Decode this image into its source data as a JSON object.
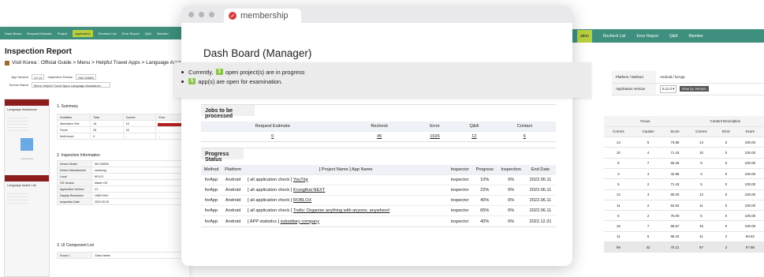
{
  "left_window": {
    "nav": [
      "Dash Board",
      "Request Estimate",
      "Project",
      "Application",
      "Recheck List",
      "Error Report",
      "Q&A",
      "Member"
    ],
    "nav_active": "Application",
    "title": "Inspection Report",
    "breadcrumb": "Visit Korea : Official Guide > Menu > Helpful Travel Apps > Language Assist",
    "app_version_label": "App Version",
    "app_version_value": "V2.12",
    "inspection_device_label": "Inspection Device",
    "inspection_device_value": "SM-G960N",
    "screen_name_label": "Screen Name",
    "screen_name_value": "Menu Helpful Travel Apps Language Assistance",
    "phone_heading": "Language Assistance",
    "phone_heading_2": "Language Assist  List",
    "phone_apps_label": "Applications",
    "summary_title": "1. Summary",
    "summary_headers": [
      "Guideline",
      "Total",
      "Correct",
      "Error"
    ],
    "summary_rows": [
      [
        "Alternative Text",
        "16",
        "15",
        "0"
      ],
      [
        "Focus",
        "28",
        "16",
        "-"
      ],
      [
        "Multi-touch",
        "0",
        "-",
        "-"
      ]
    ],
    "inspection_info_title": "2. Inspection Information",
    "inspection_info": [
      [
        "Device Model",
        "SM-G960N"
      ],
      [
        "Device Manufacturer",
        "samsung"
      ],
      [
        "Local",
        "KR-KO"
      ],
      [
        "OS Version",
        "Maker OS"
      ],
      [
        "Application Version",
        "V1"
      ],
      [
        "Display Resolution",
        "1080*1920"
      ],
      [
        "Inspection Date",
        "2022.05.25"
      ]
    ],
    "ui_component_title": "3. UI Component List",
    "ui_component_first": "Focus 1.",
    "ui_component_col": "Class Name"
  },
  "right_window": {
    "nav": [
      "ation",
      "Recheck List",
      "Error Report",
      "Q&A",
      "Member"
    ],
    "platform_label": "Platform / Method",
    "platform_value": "Android / forApp",
    "appver_label": "Application Version",
    "appver_value": "5.11.0",
    "view_button": "View by Version",
    "focus_header": "Focus",
    "content_header": "Content Description",
    "sub_headers": [
      "Correct",
      "Caution",
      "Score",
      "Correct",
      "Error",
      "Score"
    ],
    "rows": [
      [
        "14",
        "5",
        "73.68",
        "14",
        "0",
        "100.00"
      ],
      [
        "10",
        "4",
        "71.43",
        "10",
        "0",
        "100.00"
      ],
      [
        "9",
        "7",
        "56.25",
        "9",
        "0",
        "100.00"
      ],
      [
        "3",
        "4",
        "42.86",
        "3",
        "0",
        "100.00"
      ],
      [
        "5",
        "2",
        "71.43",
        "5",
        "0",
        "100.00"
      ],
      [
        "12",
        "3",
        "80.00",
        "12",
        "0",
        "100.00"
      ],
      [
        "11",
        "2",
        "84.62",
        "11",
        "0",
        "100.00"
      ],
      [
        "6",
        "2",
        "75.00",
        "6",
        "0",
        "100.00"
      ],
      [
        "16",
        "7",
        "69.57",
        "16",
        "0",
        "100.00"
      ],
      [
        "11",
        "6",
        "68.42",
        "11",
        "2",
        "84.62"
      ]
    ],
    "total_row": [
      "99",
      "42",
      "70.21",
      "97",
      "2",
      "97.98"
    ]
  },
  "banner": {
    "line1_prefix": "Currently,",
    "line1_count": "3",
    "line1_suffix": "open project(s) are in progress",
    "line2_count": "5",
    "line2_suffix": "app(s) are open for examination."
  },
  "main": {
    "tab_title": "membership",
    "page_title": "Dash Board (Manager)",
    "jobs_title": "Jobs to be processed",
    "jobs_headers": [
      "Request Estimate",
      "Recheck",
      "Error",
      "Q&A",
      "Contact"
    ],
    "jobs_values": [
      "0",
      "45",
      "1026",
      "12",
      "6"
    ],
    "progress_title": "Progress Status",
    "progress_headers": [
      "Method",
      "Platform",
      "[ Project Name ] App Name",
      "Inspector",
      "Progress",
      "Inspection",
      "End Date"
    ],
    "progress_rows": [
      {
        "method": "forApp",
        "platform": "Android",
        "project": "[ all application check ]",
        "app": "YouTrip",
        "inspector": "inspector",
        "progress": "10%",
        "inspection": "0%",
        "end": "2022.06.11"
      },
      {
        "method": "forApp",
        "platform": "Android",
        "project": "[ all application check ]",
        "app": "Krungthai NEXT",
        "inspector": "inspector",
        "progress": "22%",
        "inspection": "0%",
        "end": "2022.06.11"
      },
      {
        "method": "forApp",
        "platform": "Android",
        "project": "[ all application check ]",
        "app": "ROBLOX",
        "inspector": "inspector",
        "progress": "40%",
        "inspection": "0%",
        "end": "2022.06.11"
      },
      {
        "method": "forApp",
        "platform": "Android",
        "project": "[ all application check ]",
        "app": "Trello: Organize anything with anyone, anywhere!",
        "inspector": "inspector",
        "progress": "65%",
        "inspection": "0%",
        "end": "2022.06.11"
      },
      {
        "method": "forApp",
        "platform": "Android",
        "project": "[ APP statistics ]",
        "app": "subsidiary company",
        "inspector": "inspector",
        "progress": "40%",
        "inspection": "0%",
        "end": "2022.12.31"
      }
    ]
  }
}
